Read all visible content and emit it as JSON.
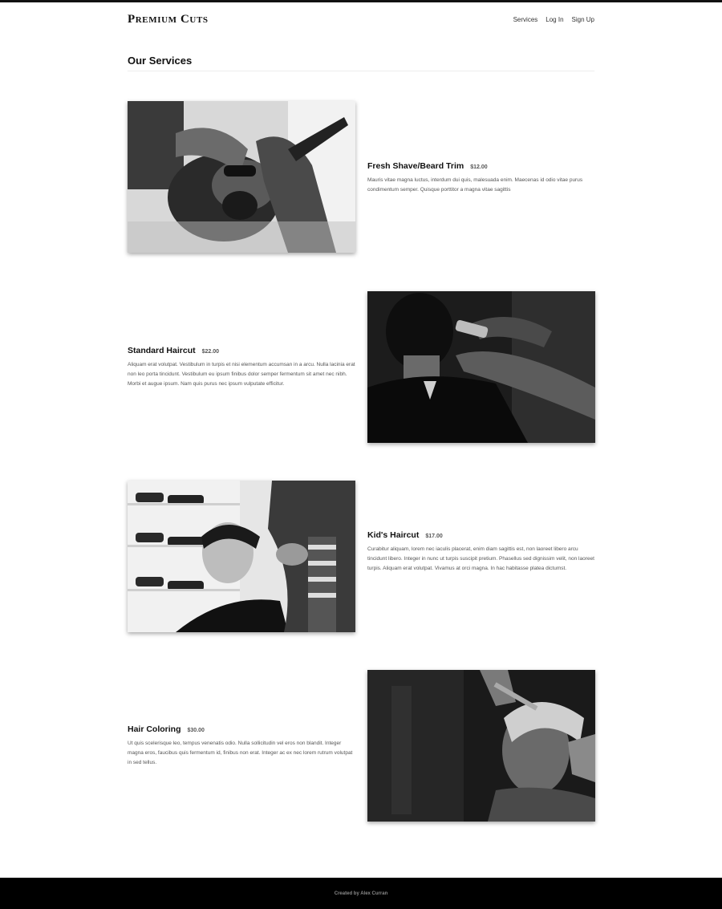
{
  "brand": "Premium Cuts",
  "nav": {
    "services": "Services",
    "login": "Log In",
    "signup": "Sign Up"
  },
  "section_title": "Our Services",
  "services": [
    {
      "name": "Fresh Shave/Beard Trim",
      "price": "$12.00",
      "description": "Mauris vitae magna luctus, interdum dui quis, malesuada enim. Maecenas id odio vitae purus condimentum semper. Quisque porttitor a magna vitae sagittis"
    },
    {
      "name": "Standard Haircut",
      "price": "$22.00",
      "description": "Aliquam erat volutpat. Vestibulum in turpis et nisi elementum accumsan in a arcu. Nulla lacinia erat non leo porta tincidunt. Vestibulum eu ipsum finibus dolor semper fermentum sit amet nec nibh. Morbi et augue ipsum. Nam quis purus nec ipsum vulputate efficitur."
    },
    {
      "name": "Kid's Haircut",
      "price": "$17.00",
      "description": "Curabitur aliquam, lorem nec iaculis placerat, enim diam sagittis est, non laoreet libero arcu tincidunt libero. Integer in nunc ut turpis suscipit pretium. Phasellus sed dignissim velit, non laoreet turpis. Aliquam erat volutpat. Vivamus at orci magna. In hac habitasse platea dictumst."
    },
    {
      "name": "Hair Coloring",
      "price": "$30.00",
      "description": "Ut quis scelerisque leo, tempus venenatis odio. Nulla sollicitudin vel eros non blandit. Integer magna eros, faucibus quis fermentum id, finibus non erat. Integer ac ex nec lorem rutrum volutpat in sed tellus."
    }
  ],
  "footer": "Created by Alex Curran",
  "colors": {
    "topbar": "#111111",
    "footer_bg": "#000000",
    "text": "#111111",
    "muted": "#555555"
  }
}
